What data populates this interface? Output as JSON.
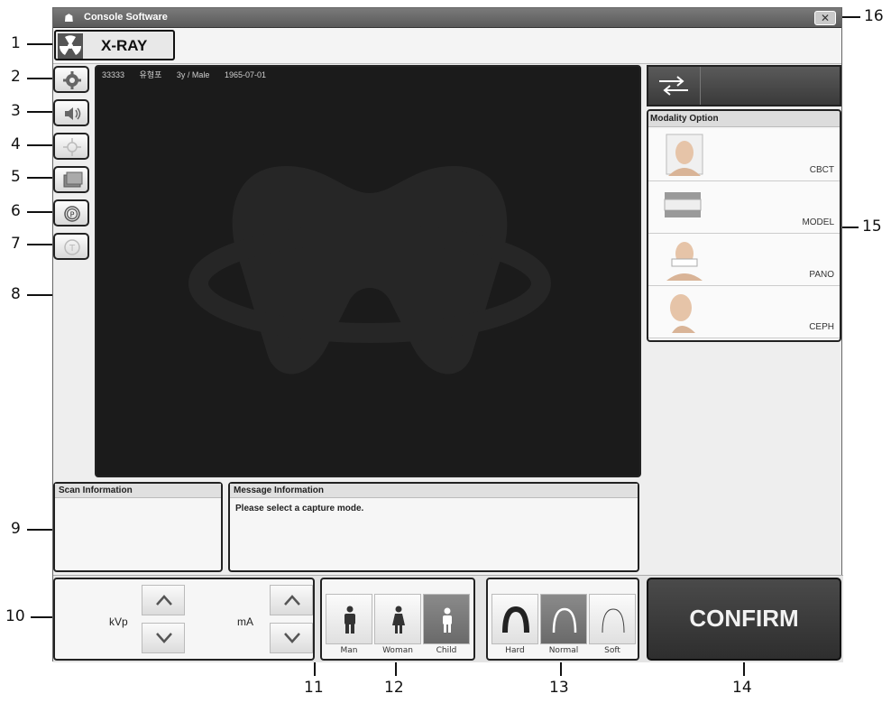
{
  "window": {
    "title": "Console Software",
    "close_symbol": "✕"
  },
  "header": {
    "mode_label": "X-RAY"
  },
  "sidebar": {
    "buttons": [
      {
        "name": "settings",
        "icon": "gear-icon"
      },
      {
        "name": "sound",
        "icon": "speaker-icon"
      },
      {
        "name": "laser",
        "icon": "laser-icon"
      },
      {
        "name": "screen",
        "icon": "screen-icon"
      },
      {
        "name": "position",
        "icon": "p-target-icon"
      },
      {
        "name": "test",
        "icon": "t-circle-icon"
      }
    ]
  },
  "viewer": {
    "patient_id": "33333",
    "patient_name": "유형포",
    "age_sex": "3y / Male",
    "birth_date": "1965-07-01"
  },
  "scan_info": {
    "title": "Scan Information",
    "text": ""
  },
  "message_info": {
    "title": "Message Information",
    "text": "Please select a capture mode."
  },
  "controls": {
    "kvp_label": "kVp",
    "ma_label": "mA",
    "patient_types": [
      {
        "label": "Man",
        "selected": false
      },
      {
        "label": "Woman",
        "selected": false
      },
      {
        "label": "Child",
        "selected": true
      }
    ],
    "densities": [
      {
        "label": "Hard",
        "selected": false
      },
      {
        "label": "Normal",
        "selected": true
      },
      {
        "label": "Soft",
        "selected": false
      }
    ],
    "confirm_label": "CONFIRM"
  },
  "modality": {
    "title": "Modality Option",
    "options": [
      {
        "label": "CBCT"
      },
      {
        "label": "MODEL"
      },
      {
        "label": "PANO"
      },
      {
        "label": "CEPH"
      }
    ]
  },
  "callouts": [
    "1",
    "2",
    "3",
    "4",
    "5",
    "6",
    "7",
    "8",
    "9",
    "10",
    "11",
    "12",
    "13",
    "14",
    "15",
    "16"
  ]
}
